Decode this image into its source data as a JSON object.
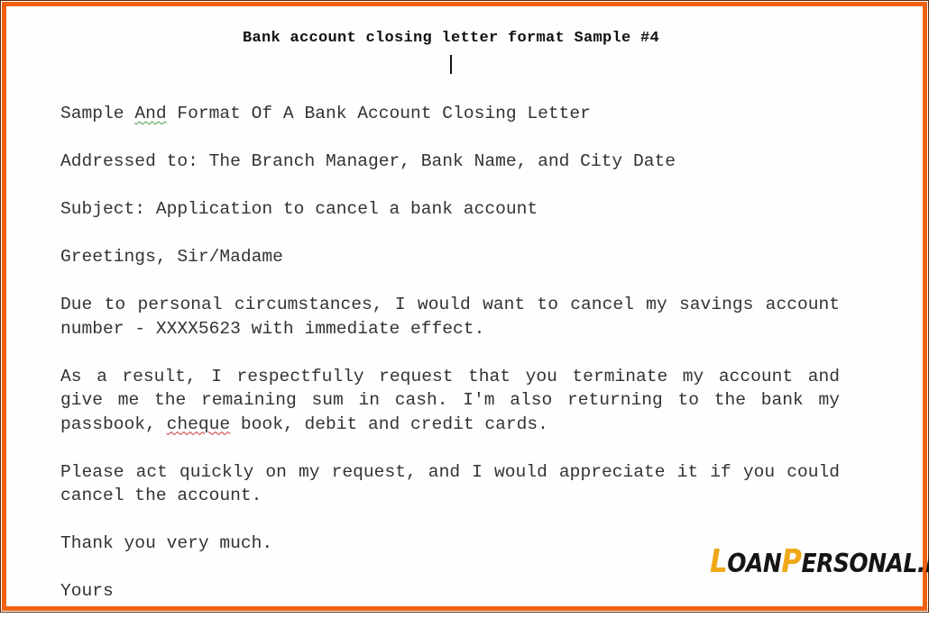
{
  "document": {
    "title": "Bank account closing letter format Sample #4",
    "heading_prefix": "Sample ",
    "heading_flagged_word": "And",
    "heading_suffix": " Format Of A Bank Account Closing Letter",
    "addressed_to": "Addressed to: The Branch Manager, Bank Name, and City Date",
    "subject": "Subject: Application to cancel a bank account",
    "greeting": "Greetings, Sir/Madame",
    "paragraph_1": "Due to personal circumstances, I would want to cancel my savings account number - XXXX5623 with immediate effect.",
    "paragraph_2_before": "As a result, I respectfully request that you terminate my account and give me the remaining sum in cash. I'm also returning to the bank my passbook, ",
    "paragraph_2_flagged_word": "cheque",
    "paragraph_2_after": " book, debit and credit cards.",
    "paragraph_3": "Please act quickly on my request, and I would appreciate it if you could cancel the account.",
    "thanks": "Thank you very much.",
    "closing": "Yours"
  },
  "logo": {
    "accent_letter_1": "L",
    "text_1": "OAN",
    "accent_letter_2": "P",
    "text_2": "ERSONAL.in"
  },
  "colors": {
    "border": "#f0620f",
    "logo_accent": "#f0a818"
  }
}
